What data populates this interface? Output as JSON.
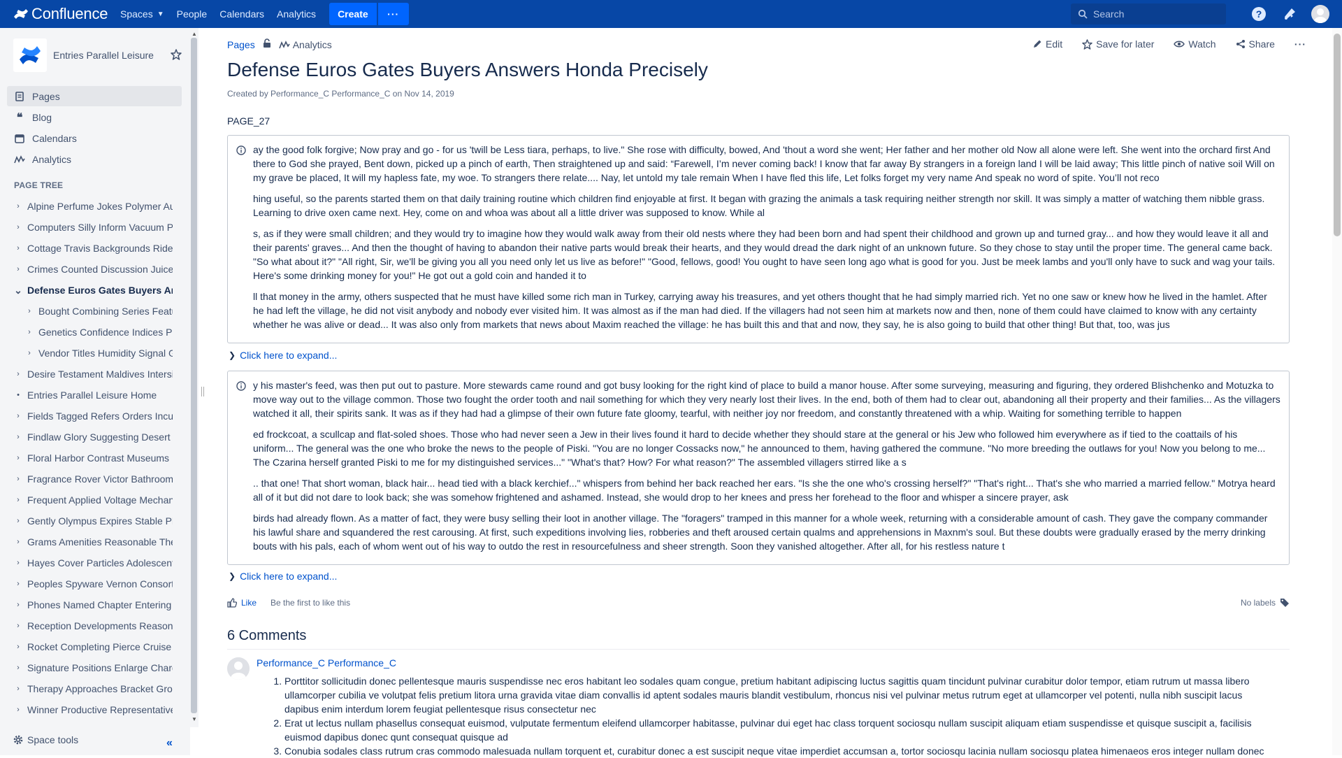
{
  "topnav": {
    "logo": "Confluence",
    "items": [
      {
        "label": "Spaces"
      },
      {
        "label": "People"
      },
      {
        "label": "Calendars"
      },
      {
        "label": "Analytics"
      }
    ],
    "create": "Create",
    "more": "···",
    "search_placeholder": "Search"
  },
  "sidebar": {
    "space_name": "Entries Parallel Leisure",
    "nav": [
      {
        "label": "Pages",
        "icon": "pages-icon"
      },
      {
        "label": "Blog",
        "icon": "blog-quote-icon"
      },
      {
        "label": "Calendars",
        "icon": "calendar-icon"
      },
      {
        "label": "Analytics",
        "icon": "analytics-icon"
      }
    ],
    "tree_title": "PAGE TREE",
    "tree": [
      {
        "label": "Alpine Perfume Jokes Polymer Au",
        "level": 0,
        "toggle": "›"
      },
      {
        "label": "Computers Silly Inform Vacuum P",
        "level": 0,
        "toggle": "›"
      },
      {
        "label": "Cottage Travis Backgrounds Ride",
        "level": 0,
        "toggle": "›"
      },
      {
        "label": "Crimes Counted Discussion Juice",
        "level": 0,
        "toggle": "›"
      },
      {
        "label": "Defense Euros Gates Buyers Ar",
        "level": 0,
        "toggle": "⌄",
        "current": true
      },
      {
        "label": "Bought Combining Series Featu",
        "level": 1,
        "toggle": "›"
      },
      {
        "label": "Genetics Confidence Indices Pa",
        "level": 1,
        "toggle": "›"
      },
      {
        "label": "Vendor Titles Humidity Signal G",
        "level": 1,
        "toggle": "›"
      },
      {
        "label": "Desire Testament Maldives Intersi",
        "level": 0,
        "toggle": "›"
      },
      {
        "label": "Entries Parallel Leisure Home",
        "level": 0,
        "toggle": "•"
      },
      {
        "label": "Fields Tagged Refers Orders Incu",
        "level": 0,
        "toggle": "›"
      },
      {
        "label": "Findlaw Glory Suggesting Desert",
        "level": 0,
        "toggle": "›"
      },
      {
        "label": "Floral Harbor Contrast Museums I",
        "level": 0,
        "toggle": "›"
      },
      {
        "label": "Fragrance Rover Victor Bathroom",
        "level": 0,
        "toggle": "›"
      },
      {
        "label": "Frequent Applied Voltage Mechan",
        "level": 0,
        "toggle": "›"
      },
      {
        "label": "Gently Olympus Expires Stable Pl",
        "level": 0,
        "toggle": "›"
      },
      {
        "label": "Grams Amenities Reasonable The",
        "level": 0,
        "toggle": "›"
      },
      {
        "label": "Hayes Cover Particles Adolescent",
        "level": 0,
        "toggle": "›"
      },
      {
        "label": "Peoples Spyware Vernon Consort",
        "level": 0,
        "toggle": "›"
      },
      {
        "label": "Phones Named Chapter Entering",
        "level": 0,
        "toggle": "›"
      },
      {
        "label": "Reception Developments Reason",
        "level": 0,
        "toggle": "›"
      },
      {
        "label": "Rocket Completing Pierce Cruise",
        "level": 0,
        "toggle": "›"
      },
      {
        "label": "Signature Positions Enlarge Charg",
        "level": 0,
        "toggle": "›"
      },
      {
        "label": "Therapy Approaches Bracket Gro",
        "level": 0,
        "toggle": "›"
      },
      {
        "label": "Winner Productive Representative",
        "level": 0,
        "toggle": "›"
      }
    ],
    "space_tools": "Space tools",
    "collapse": "«"
  },
  "page": {
    "breadcrumb": "Pages",
    "analytics": "Analytics",
    "actions": {
      "edit": "Edit",
      "save": "Save for later",
      "watch": "Watch",
      "share": "Share",
      "more": "···"
    },
    "title": "Defense Euros Gates Buyers Answers Honda Precisely",
    "byline": "Created by Performance_C Performance_C on Nov 14, 2019",
    "id": "PAGE_27",
    "panel1": [
      "ay the good folk forgive; Now pray and go - for us 'twill be Less tiara, perhaps, to live.\" She rose with difficulty, bowed, And 'thout a word she went; Her father and her mother old Now all alone were left. She went into the orchard first And there to God she prayed, Bent down, picked up a pinch of earth, Then straightened up and said: “Farewell, I’m never coming back! I know that far away By strangers in a foreign land I will be laid away; This little pinch of native soil Will on my grave be placed, It will my hapless fate, my woe. To strangers there relate.... Nay, let untold my tale remain When I have fled this life, Let folks forget my very name And speak no word of spite. You’ll not reco",
      "hing useful, so the parents started them on that daily training routine which children find enjoyable at first. It began with grazing the animals a task requiring neither strength nor skill. It was simply a matter of watching them nibble grass. Learning to drive oxen came next. Hey, come on and whoa was about all a little driver was supposed to know. While al",
      "s, as if they were small children; and they would try to imagine how they would walk away from their old nests where they had been born and had spent their childhood and grown up and turned gray... and how they would leave it all and their parents' graves... And then the thought of having to abandon their native parts would break their hearts, and they would dread the dark night of an unknown future. So they chose to stay until the proper time. The general came back. \"So what about it?\" \"All right, Sir, we'll be giving you all you need only let us live as before!\" \"Good, fellows, good! You ought to have seen long ago what is good for you. Just be meek lambs and you'll only have to suck and wag your tails. Here's some drinking money for you!\" He got out a gold coin and handed it to",
      "ll that money in the army, others suspected that he must have killed some rich man in Turkey, carrying away his treasures, and yet others thought that he had simply married rich. Yet no one saw or knew how he lived in the hamlet. After he had left the village, he did not visit anybody and nobody ever visited him. It was almost as if the man had died. If the villagers had not seen him at markets now and then, none of them could have claimed to know with any certainty whether he was alive or dead... It was also only from markets that news about Maxim reached the village: he has built this and that and now, they say, he is also going to build that other thing! But that, too, was jus"
    ],
    "expand1": "Click here to expand...",
    "panel2": [
      "y his master's feed, was then put out to pasture. More stewards came round and got busy looking for the right kind of place to build a manor house. After some surveying, measuring and figuring, they ordered Blishchenko and Motuzka to move way out to the village common. Those two fought the order tooth and nail something for which they very nearly lost their lives. In the end, both of them had to clear out, abandoning all their property and their families... As the villagers watched it all, their spirits sank. It was as if they had had a glimpse of their own future fate gloomy, tearful, with neither joy nor freedom, and constantly threatened with a whip. Waiting for something terrible to happen",
      "ed frockcoat, a scullcap and flat-soled shoes. Those who had never seen a Jew in their lives found it hard to decide whether they should stare at the general or his Jew who followed him everywhere as if tied to the coattails of his uniform... The general was the one who broke the news to the people of Piski. \"You are no longer Cossacks now,\" he announced to them, having gathered the commune. \"No more breeding the outlaws for you! Now you belong to me... The Czarina herself granted Piski to me for my distinguished services...\" \"What's that? How? For what reason?\" The assembled villagers stirred like a s",
      ".. that one! That short woman, black hair... head tied with a black kerchief...\" whispers from behind her back reached her ears. \"Is she the one who's crossing herself?\" \"That's right... That's she who married a married fellow.\" Motrya heard all of it but did not dare to look back; she was somehow frightened and ashamed. Instead, she would drop to her knees and press her forehead to the floor and whisper a sincere prayer, ask",
      "birds had already flown. As a matter of fact, they were busy selling their loot in another village. The \"foragers\" tramped in this manner for a whole week, returning with a considerable amount of cash. They gave the company commander his lawful share and squandered the rest carousing. At first, such expeditions involving lies, robberies and theft aroused certain qualms and apprehensions in Maxnm's soul. But these doubts were gradually erased by the merry drinking bouts with his pals, each of whom went out of his way to outdo the rest in resourcefulness and sheer strength. Soon they vanished altogether. After all, for his restless nature t"
    ],
    "expand2": "Click here to expand...",
    "like": "Like",
    "like_hint": "Be the first to like this",
    "labels": "No labels"
  },
  "comments": {
    "title": "6 Comments",
    "items": [
      {
        "author": "Performance_C Performance_C",
        "lines": [
          "Porttitor sollicitudin donec pellentesque mauris suspendisse nec eros habitant leo sodales quam congue, pretium habitant adipiscing luctus sagittis quam tincidunt pulvinar curabitur dolor tempor, etiam rutrum ut massa libero ullamcorper cubilia ve volutpat felis pretium litora urna gravida vitae diam convallis id aptent sodales mauris blandit vestibulum, rhoncus nisi vel pulvinar metus rutrum eget at ullamcorper vel potenti, nulla nibh suscipit lacus dapibus enim interdum lorem feugiat pellentesque risus consectetur nec",
          "Erat ut lectus nullam phasellus consequat euismod, vulputate fermentum eleifend ullamcorper habitasse, pulvinar dui eget hac class torquent sociosqu nullam suscipit aliquam etiam suspendisse et quisque suscipit a, facilisis euismod dapibus donec qunt consequat quisque ad",
          "Conubia sodales class rutrum cras commodo malesuada nullam torquent et, curabitur donec a est suscipit neque vitae imperdiet accumsan a, tortor sociosqu lacinia nullam sociosqu platea himenaeos eros integer nullam donec"
        ]
      }
    ]
  },
  "colors": {
    "nav": "#0747a6",
    "link": "#0052cc",
    "sidebar": "#f4f5f7"
  }
}
